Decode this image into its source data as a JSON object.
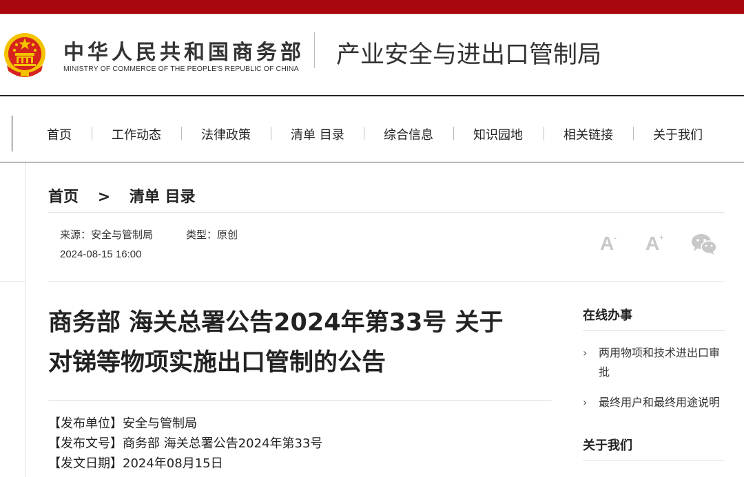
{
  "header": {
    "org_name_cn": "中华人民共和国商务部",
    "org_name_en": "MINISTRY OF COMMERCE OF THE PEOPLE'S REPUBLIC OF CHINA",
    "bureau_name": "产业安全与进出口管制局",
    "brand_color": "#a8070d"
  },
  "nav": {
    "items": [
      "首页",
      "工作动态",
      "法律政策",
      "清单 目录",
      "综合信息",
      "知识园地",
      "相关链接",
      "关于我们"
    ]
  },
  "breadcrumb": {
    "home": "首页",
    "separator": ">",
    "current": "清单 目录"
  },
  "meta": {
    "source": "来源：安全与管制局",
    "type": "类型：原创",
    "date": "2024-08-15 16:00"
  },
  "tools": {
    "font_small": "A",
    "font_large": "A",
    "font_small_sup": "-",
    "font_large_sup": "+",
    "share_icon": "wechat-icon"
  },
  "article": {
    "title_line1": "商务部 海关总署公告2024年第33号 关于",
    "title_line2": "对锑等物项实施出口管制的公告",
    "info": [
      "【发布单位】安全与管制局",
      "【发布文号】商务部 海关总署公告2024年第33号",
      "【发文日期】2024年08月15日"
    ]
  },
  "sidebar": {
    "online_heading": "在线办事",
    "links": [
      "两用物项和技术进出口审批",
      "最终用户和最终用途说明"
    ],
    "about_heading": "关于我们"
  }
}
